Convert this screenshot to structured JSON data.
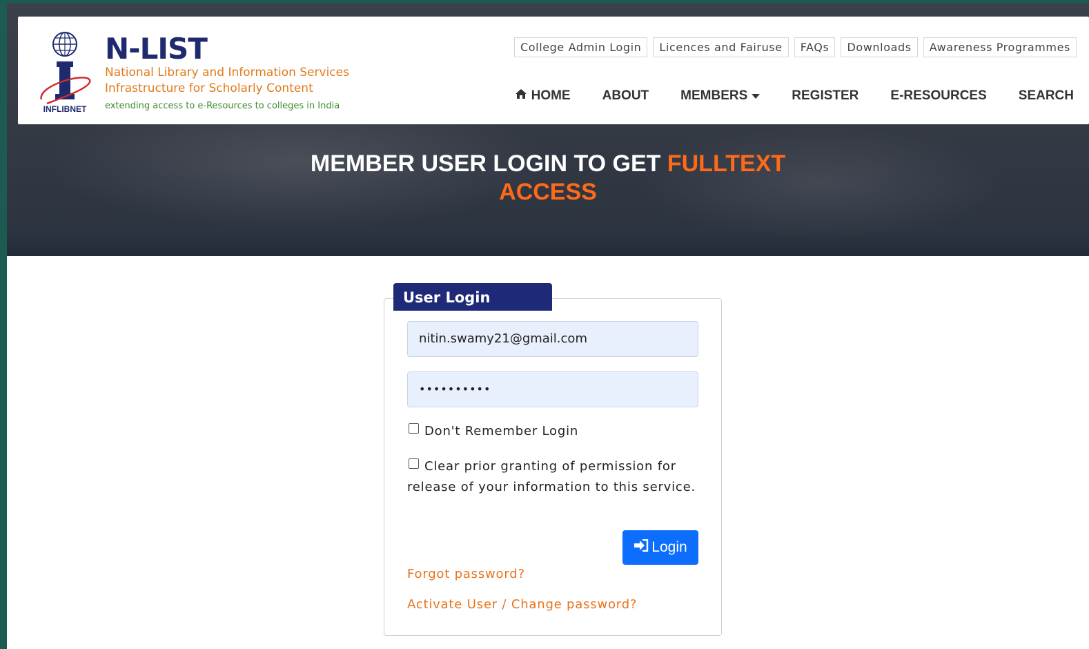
{
  "site": {
    "title": "N-LIST",
    "subtitle_line1": "National Library and Information Services",
    "subtitle_line2": "Infrastructure for Scholarly Content",
    "tagline": "extending access to e-Resources to colleges in India",
    "logo_text": "INFLIBNET"
  },
  "top_links": [
    "College Admin Login",
    "Licences and Fairuse",
    "FAQs",
    "Downloads",
    "Awareness Programmes"
  ],
  "nav": {
    "home": "HOME",
    "about": "ABOUT",
    "members": "MEMBERS",
    "register": "REGISTER",
    "eresources": "E-RESOURCES",
    "search": "SEARCH"
  },
  "hero": {
    "title_plain": "MEMBER USER LOGIN TO GET ",
    "title_accent_1": "FULLTEXT",
    "title_accent_2": "ACCESS"
  },
  "login": {
    "legend": "User Login",
    "email_value": "nitin.swamy21@gmail.com",
    "password_masked": "••••••••••",
    "dont_remember_label": "Don't Remember Login",
    "clear_permission_line1": "Clear prior granting of permission for",
    "clear_permission_line2": "release of your information to this service.",
    "login_button": "Login",
    "forgot_password": "Forgot password?",
    "activate_change": "Activate User / Change password?"
  },
  "colors": {
    "brand_navy": "#1f2a6e",
    "accent_orange": "#ff6a1a",
    "link_orange": "#e8731b",
    "button_blue": "#0d6efd",
    "legend_navy": "#1e2a78",
    "input_bg": "#e8f0fe"
  }
}
